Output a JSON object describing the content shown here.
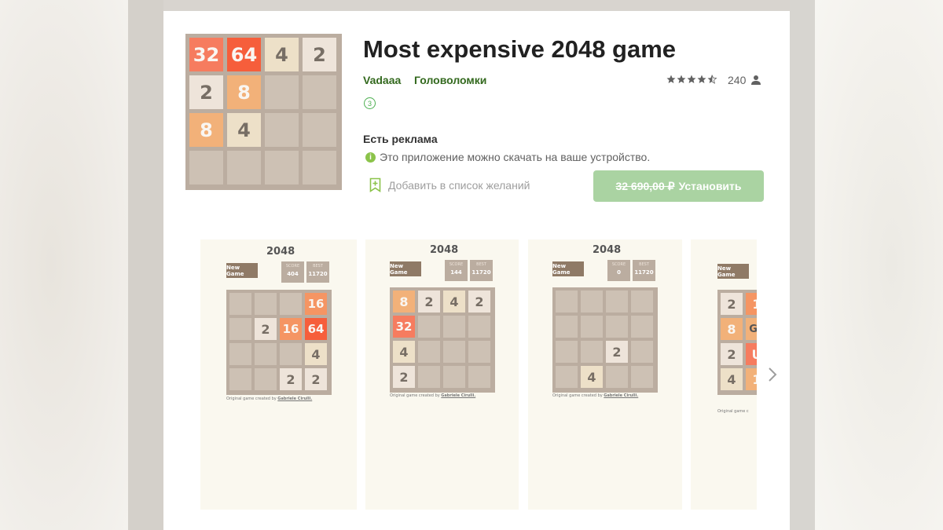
{
  "app": {
    "title": "Most expensive 2048 game",
    "developer": "Vadaaa",
    "category": "Головоломки",
    "rating_count": "240",
    "age_rating": "3",
    "ads_notice": "Есть реклама",
    "compat_notice": "Это приложение можно скачать на ваше устройство.",
    "wishlist_label": "Добавить в список желаний",
    "old_price": "32 690,00 ₽",
    "install_label": "Установить",
    "rating_stars": 4.5,
    "icon_tiles": [
      "32",
      "64",
      "4",
      "2",
      "2",
      "8",
      "",
      "",
      "8",
      "4",
      "",
      "",
      "",
      "",
      "",
      ""
    ]
  },
  "screenshots": [
    {
      "title": "2048",
      "new_game": "New Game",
      "score_label": "SCORE",
      "score": "404",
      "best_label": "BEST",
      "best": "11720",
      "tiles": [
        "",
        "",
        "",
        "16",
        "",
        "2",
        "16",
        "64",
        "",
        "",
        "",
        "4",
        "",
        "",
        "2",
        "2"
      ],
      "credit_prefix": "Original game created by",
      "credit_name": "Gabriele Cirulli."
    },
    {
      "title": "2048",
      "new_game": "New Game",
      "score_label": "SCORE",
      "score": "144",
      "best_label": "BEST",
      "best": "11720",
      "tiles": [
        "8",
        "2",
        "4",
        "2",
        "32",
        "",
        "",
        "",
        "4",
        "",
        "",
        "",
        "2",
        "",
        "",
        ""
      ],
      "credit_prefix": "Original game created by",
      "credit_name": "Gabriele Cirulli."
    },
    {
      "title": "2048",
      "new_game": "New Game",
      "score_label": "SCORE",
      "score": "0",
      "best_label": "BEST",
      "best": "11720",
      "tiles": [
        "",
        "",
        "",
        "",
        "",
        "",
        "",
        "",
        "",
        "",
        "2",
        "",
        "",
        "4",
        "",
        ""
      ],
      "credit_prefix": "Original game created by",
      "credit_name": "Gabriele Cirulli."
    },
    {
      "new_game": "New Game",
      "tiles": [
        "2",
        "1",
        "",
        "",
        "8",
        "Ga",
        "",
        "",
        "2",
        "U",
        "",
        "",
        "4",
        "1",
        "",
        ""
      ],
      "credit_prefix": "Original game c"
    }
  ],
  "tile_colors": {
    "2": {
      "bg": "#eee4da",
      "fg": "#776e65"
    },
    "4": {
      "bg": "#ede0c8",
      "fg": "#776e65"
    },
    "8": {
      "bg": "#f2b179",
      "fg": "#f9f6f2"
    },
    "16": {
      "bg": "#f59563",
      "fg": "#f9f6f2"
    },
    "32": {
      "bg": "#f67c5f",
      "fg": "#f9f6f2"
    },
    "64": {
      "bg": "#f65e3b",
      "fg": "#f9f6f2"
    }
  }
}
